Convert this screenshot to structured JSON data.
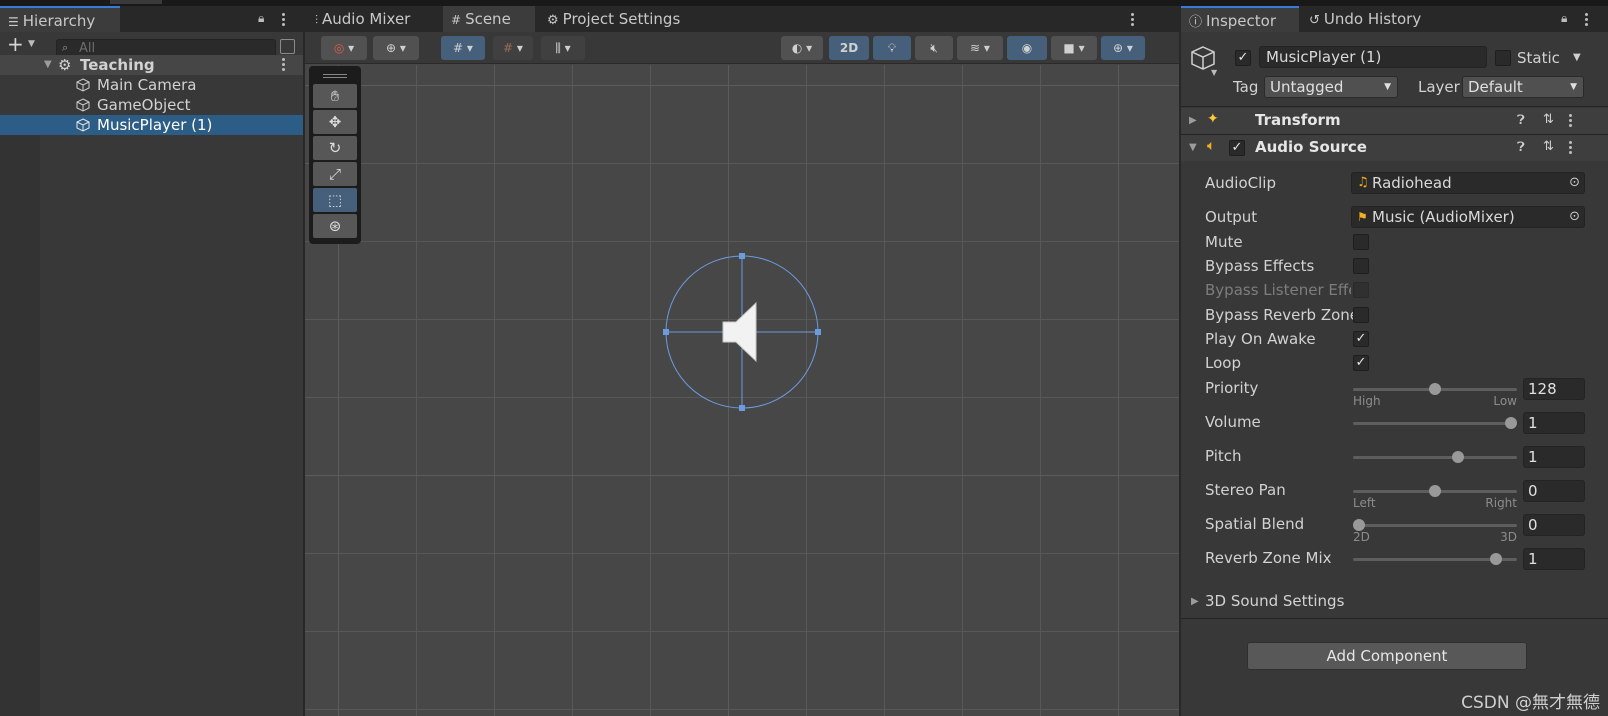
{
  "hierarchy": {
    "tab_label": "Hierarchy",
    "search_placeholder": "All",
    "scene_name": "Teaching",
    "items": [
      {
        "label": "Main Camera"
      },
      {
        "label": "GameObject"
      },
      {
        "label": "MusicPlayer (1)"
      }
    ]
  },
  "scene_view": {
    "tabs": [
      {
        "label": "Audio Mixer"
      },
      {
        "label": "Scene"
      },
      {
        "label": "Project Settings"
      }
    ],
    "mode_2d_label": "2D"
  },
  "inspector": {
    "tabs": [
      {
        "label": "Inspector"
      },
      {
        "label": "Undo History"
      }
    ],
    "object_name": "MusicPlayer (1)",
    "object_active": true,
    "static_label": "Static",
    "tag_label": "Tag",
    "tag_value": "Untagged",
    "layer_label": "Layer",
    "layer_value": "Default",
    "components": {
      "transform": {
        "name": "Transform"
      },
      "audio_source": {
        "name": "Audio Source",
        "enabled": true,
        "fields": {
          "audio_clip": {
            "label": "AudioClip",
            "value": "Radiohead"
          },
          "output": {
            "label": "Output",
            "value": "Music (AudioMixer)"
          },
          "mute": {
            "label": "Mute",
            "checked": false
          },
          "bypass_effects": {
            "label": "Bypass Effects",
            "checked": false
          },
          "bypass_listener": {
            "label": "Bypass Listener Effe",
            "checked": false
          },
          "bypass_reverb": {
            "label": "Bypass Reverb Zone",
            "checked": false
          },
          "play_on_awake": {
            "label": "Play On Awake",
            "checked": true
          },
          "loop": {
            "label": "Loop",
            "checked": true
          },
          "priority": {
            "label": "Priority",
            "value": "128",
            "min_label": "High",
            "max_label": "Low",
            "fraction": 0.5
          },
          "volume": {
            "label": "Volume",
            "value": "1",
            "fraction": 1.0
          },
          "pitch": {
            "label": "Pitch",
            "value": "1",
            "fraction": 0.65
          },
          "stereo_pan": {
            "label": "Stereo Pan",
            "value": "0",
            "min_label": "Left",
            "max_label": "Right",
            "fraction": 0.5
          },
          "spatial_blend": {
            "label": "Spatial Blend",
            "value": "0",
            "min_label": "2D",
            "max_label": "3D",
            "fraction": 0.0
          },
          "reverb_zone_mix": {
            "label": "Reverb Zone Mix",
            "value": "1",
            "fraction": 0.9
          }
        },
        "sound_settings_label": "3D Sound Settings"
      }
    },
    "add_component_label": "Add Component"
  },
  "watermark": "CSDN @無才無德",
  "colors": {
    "selection": "#2c5d87",
    "accent": "#3a7bd5",
    "active_toggle": "#46607c"
  }
}
